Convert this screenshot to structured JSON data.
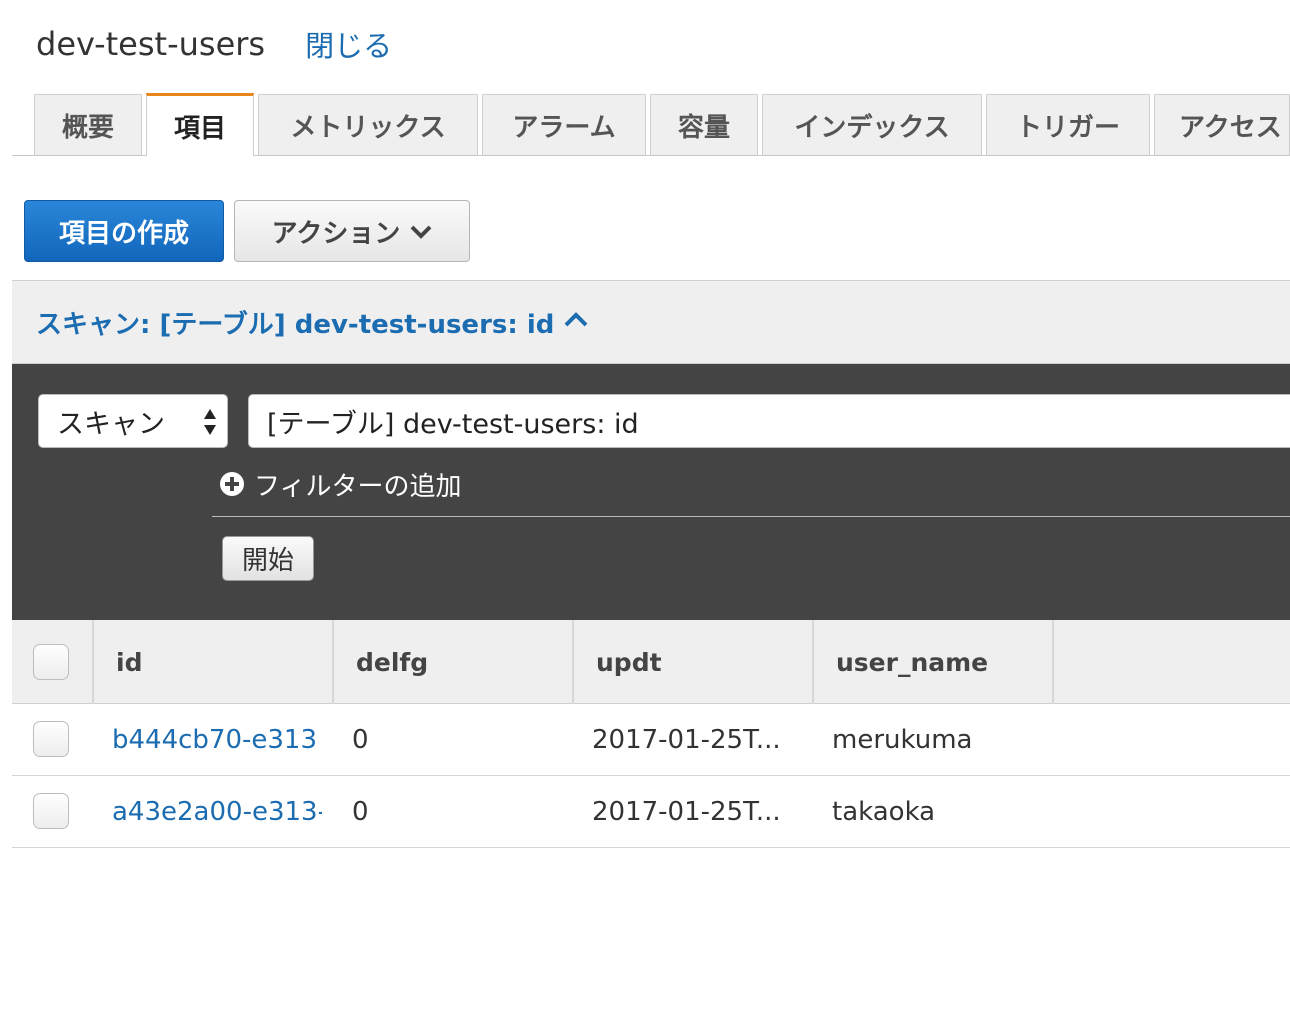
{
  "header": {
    "table_name": "dev-test-users",
    "close_label": "閉じる"
  },
  "tabs": [
    {
      "label": "概要"
    },
    {
      "label": "項目"
    },
    {
      "label": "メトリックス"
    },
    {
      "label": "アラーム"
    },
    {
      "label": "容量"
    },
    {
      "label": "インデックス"
    },
    {
      "label": "トリガー"
    },
    {
      "label": "アクセス"
    }
  ],
  "active_tab": "項目",
  "toolbar": {
    "create_item_label": "項目の作成",
    "actions_label": "アクション"
  },
  "scan_bar": {
    "title": "スキャン: [テーブル] dev-test-users: id"
  },
  "scan_panel": {
    "mode_selected": "スキャン",
    "target_value": "[テーブル] dev-test-users: id",
    "add_filter_label": "フィルターの追加",
    "start_label": "開始"
  },
  "table": {
    "columns": [
      "id",
      "delfg",
      "updt",
      "user_name"
    ],
    "rows": [
      {
        "id": "b444cb70-e313",
        "delfg": "0",
        "updt": "2017-01-25T...",
        "user_name": "merukuma"
      },
      {
        "id": "a43e2a00-e313-",
        "delfg": "0",
        "updt": "2017-01-25T...",
        "user_name": "takaoka"
      }
    ]
  },
  "colors": {
    "accent_tab": "#e8861a",
    "primary_button": "#1a73c7",
    "link": "#1b6cb0",
    "panel_bg": "#444444"
  }
}
